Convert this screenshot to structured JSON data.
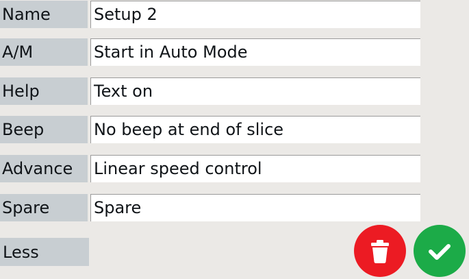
{
  "colors": {
    "delete": "#ec1b23",
    "confirm": "#1cab48"
  },
  "fields": [
    {
      "label": "Name",
      "value": "Setup 2"
    },
    {
      "label": "A/M",
      "value": "Start in Auto Mode"
    },
    {
      "label": "Help",
      "value": "Text on"
    },
    {
      "label": "Beep",
      "value": "No beep at end of slice"
    },
    {
      "label": "Advance",
      "value": "Linear speed control"
    },
    {
      "label": "Spare",
      "value": "Spare"
    }
  ],
  "less_label": "Less",
  "actions": {
    "delete_icon": "trash-icon",
    "confirm_icon": "checkmark-icon"
  }
}
